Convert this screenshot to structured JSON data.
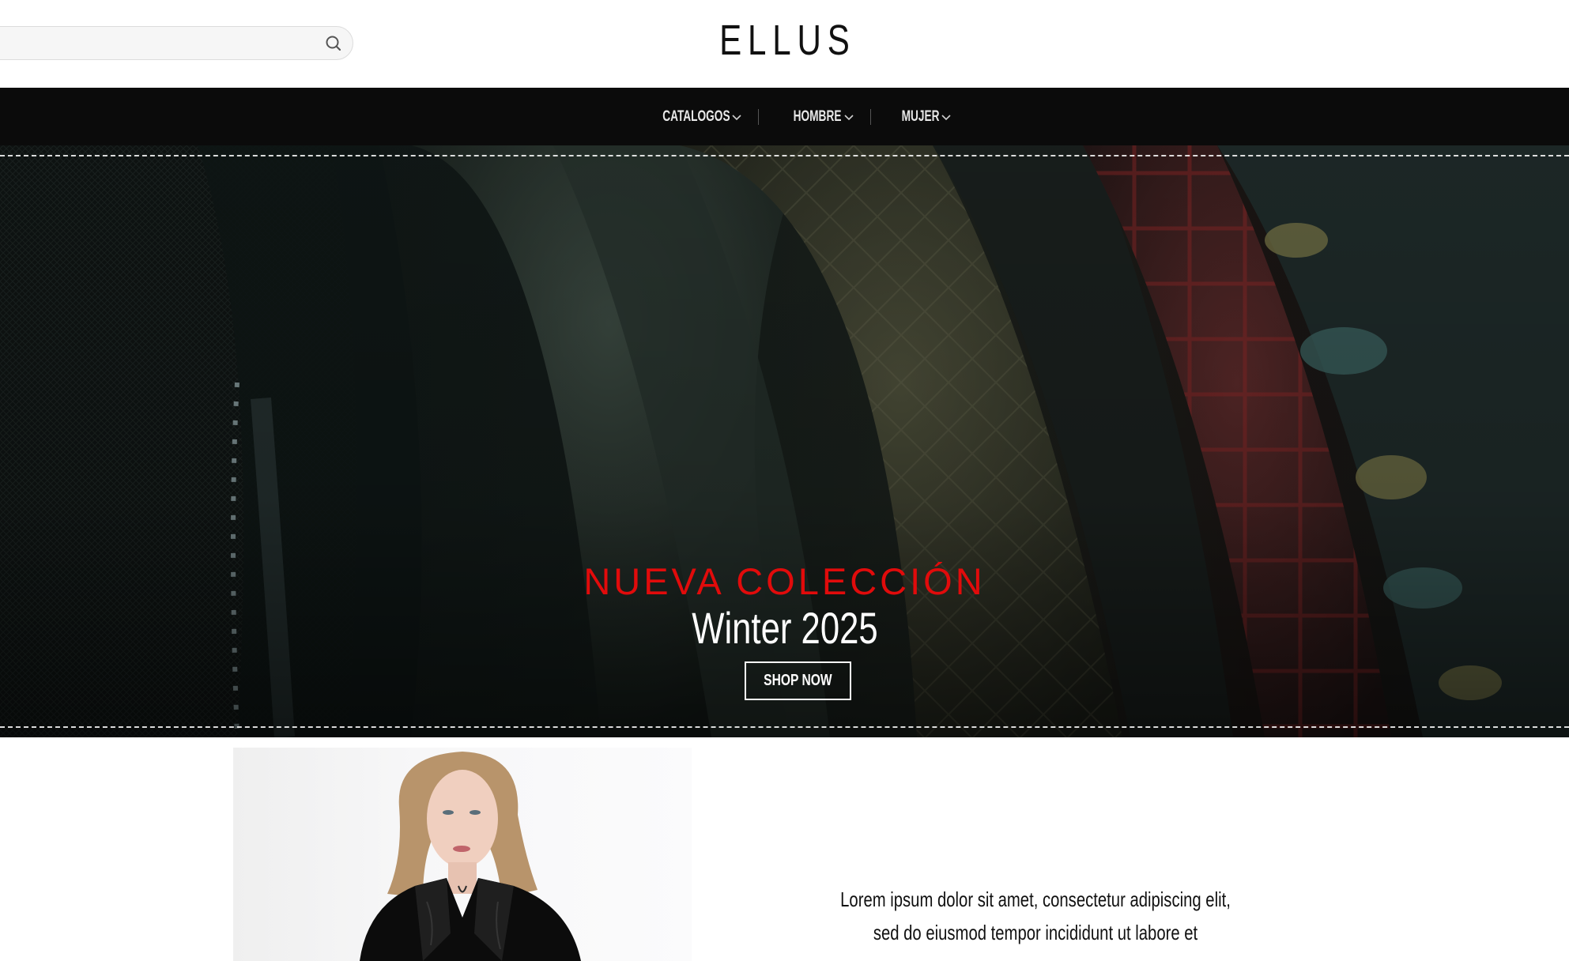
{
  "header": {
    "logo": "ELLUS",
    "search": {
      "placeholder": "",
      "value": "",
      "icon": "search-icon"
    }
  },
  "nav": {
    "items": [
      {
        "label": "CATALOGOS",
        "icon": "chevron-down-icon"
      },
      {
        "label": "HOMBRE",
        "icon": "chevron-down-icon"
      },
      {
        "label": "MUJER",
        "icon": "chevron-down-icon"
      }
    ]
  },
  "hero": {
    "kicker": "NUEVA COLECCIÓN",
    "title": "Winter 2025",
    "cta": "SHOP NOW"
  },
  "about": {
    "text": "Lorem ipsum dolor sit amet, consectetur adipiscing elit, sed do eiusmod tempor incididunt ut labore et"
  },
  "colors": {
    "nav_bg": "#0b0b0b",
    "accent_red": "#e10b0b",
    "text": "#111111"
  }
}
